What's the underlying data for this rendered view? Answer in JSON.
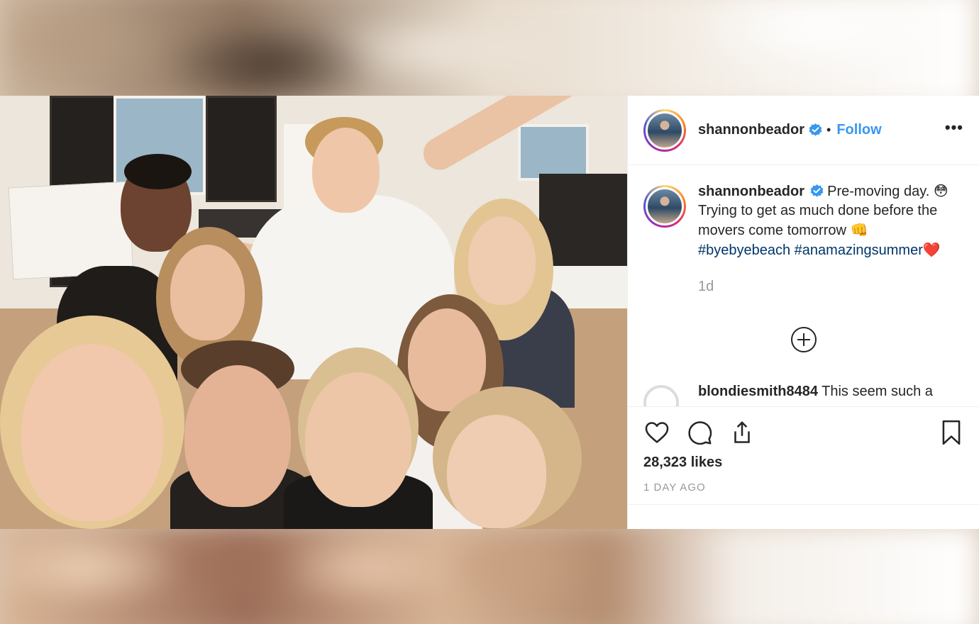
{
  "post": {
    "username": "shannonbeador",
    "follow_label": "Follow",
    "separator": "•",
    "more_label": "•••",
    "caption": {
      "username": "shannonbeador",
      "line1": "Pre-moving day.",
      "emoji1": "😳",
      "line2": "Trying to get as much done before the movers come tomorrow",
      "emoji2": "👊",
      "hashtag1": "#byebyebeach",
      "hashtag2": "#anamazingsummer",
      "emoji3": "❤️"
    },
    "caption_age": "1d",
    "comment": {
      "username": "blondiesmith8484",
      "text": "This seem such a"
    },
    "likes": "28,323 likes",
    "date": "1 DAY AGO"
  },
  "icons": {
    "verified": "verified-badge-icon",
    "like": "heart-icon",
    "comment": "comment-icon",
    "share": "share-icon",
    "save": "bookmark-icon",
    "load_more": "plus-circle-icon"
  },
  "colors": {
    "link_blue": "#3897f0",
    "hashtag": "#003569",
    "text": "#262626",
    "muted": "#999999",
    "border": "#efefef"
  }
}
